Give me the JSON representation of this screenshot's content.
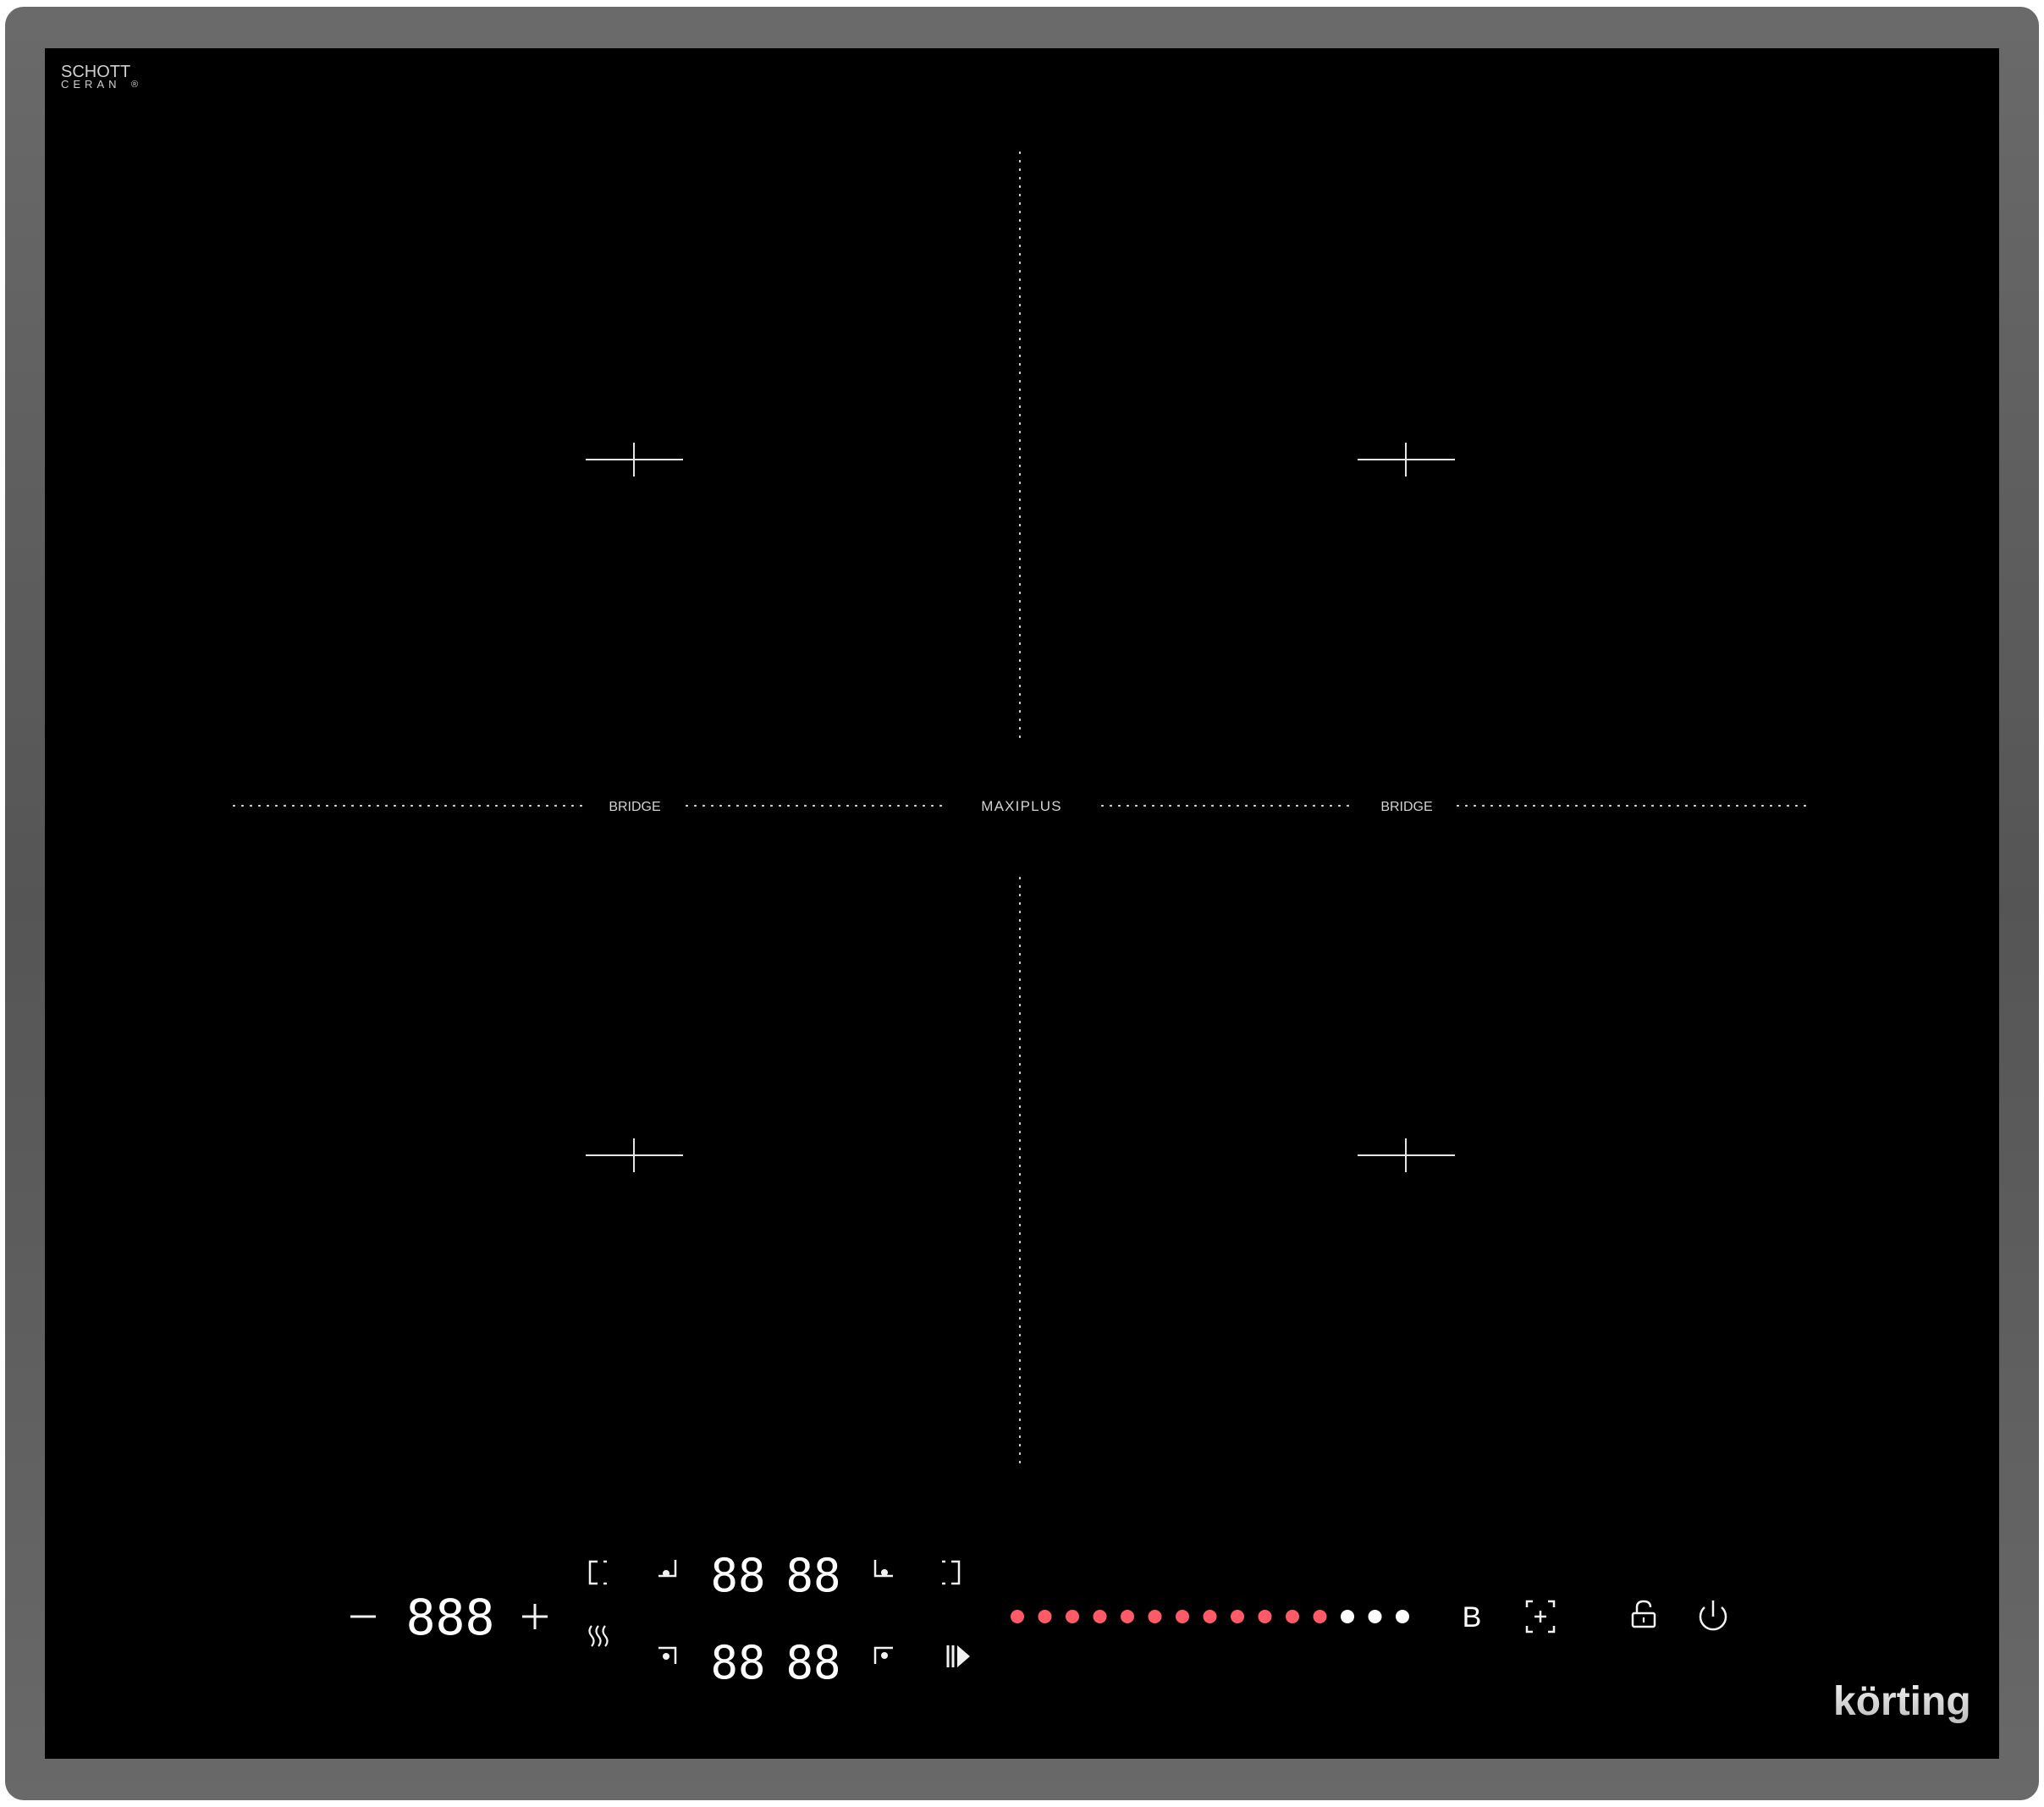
{
  "brand": {
    "glass_line1": "SCHOTT",
    "glass_line2": "CERAN",
    "glass_mark": "®",
    "logo_text": "körting"
  },
  "zones": {
    "top_left": {
      "icon": "crosshair-icon"
    },
    "top_right": {
      "icon": "crosshair-icon"
    },
    "bottom_left": {
      "icon": "crosshair-icon"
    },
    "bottom_right": {
      "icon": "crosshair-icon"
    }
  },
  "dividers": {
    "left_label": "BRIDGE",
    "center_label": "MAXIPLUS",
    "right_label": "BRIDGE"
  },
  "controls": {
    "power_minus": {
      "icon": "minus-icon"
    },
    "power_display": "888",
    "power_plus": {
      "icon": "plus-icon"
    },
    "timer_top_left": "88",
    "timer_top_right": "88",
    "timer_bottom_left": "88",
    "timer_bottom_right": "88",
    "bridge_button_label": "B",
    "icons": [
      "zone-left-bracket-icon",
      "zone-top-left-select-icon",
      "zone-top-right-select-icon",
      "zone-right-bracket-icon",
      "keep-warm-icon",
      "zone-bottom-left-select-icon",
      "zone-bottom-right-select-icon",
      "pause-play-icon",
      "boost-icon",
      "lock-icon",
      "power-icon"
    ],
    "slider": {
      "total_dots": 15,
      "active_dots": 12,
      "active_color": "#ff5a66",
      "inactive_color": "#ffffff"
    }
  },
  "colors": {
    "frame": "#5f5f5f",
    "glass": "#000000",
    "text": "#d8d8d8",
    "white": "#ffffff"
  }
}
